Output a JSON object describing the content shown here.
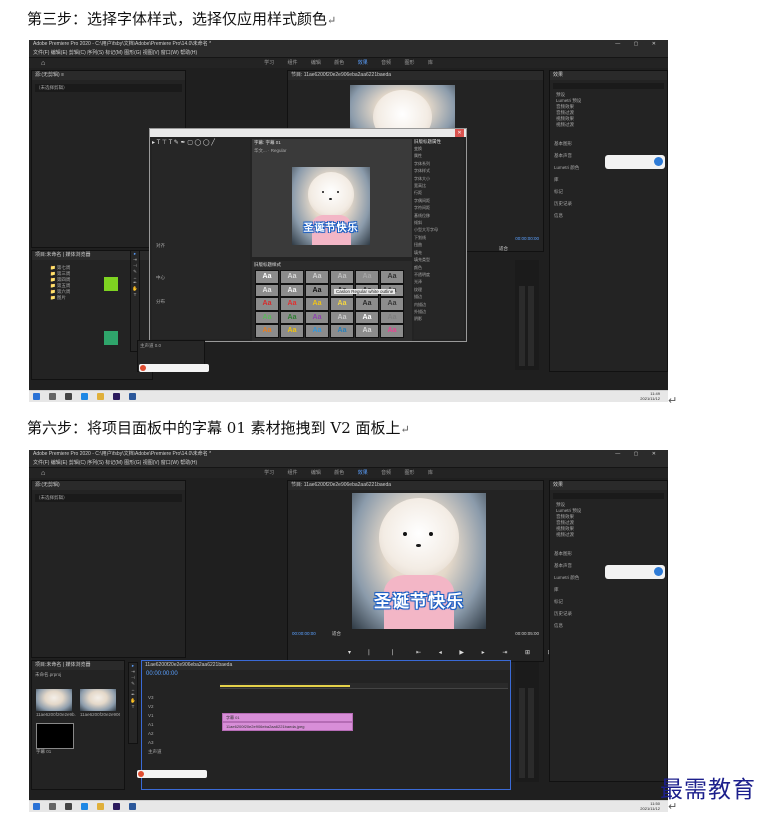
{
  "step3": {
    "heading": "第三步：选择字体样式，选择仅应用样式颜色",
    "app_title": "Adobe Premiere Pro 2020 - C:\\用户\\fsby\\文档\\Adobe\\Premiere Pro\\14.0\\未命名 *",
    "menu": "文件(F)  编辑(E)  剪辑(C)  序列(S)  标记(M)  图形(G)  视图(V)  窗口(W)  帮助(H)",
    "workspaces": [
      "学习",
      "组件",
      "编辑",
      "颜色",
      "效果",
      "音频",
      "图形",
      "库"
    ],
    "active_workspace": "效果",
    "project_tab": "项目:未命名",
    "media_tab": "媒体浏览器",
    "source_placeholder": "（未选择剪辑）",
    "program_tab": "节目: 11ae6200f20e2e906eba2aa6221baeda",
    "effects_tab": "效果",
    "effects_items": [
      "预设",
      "Lumetri 预设",
      "音频效果",
      "音频过渡",
      "视频效果",
      "视频过渡"
    ],
    "effects_side": [
      "基本图形",
      "基本声音",
      "Lumetri 颜色",
      "库",
      "标记",
      "历史记录",
      "信息"
    ],
    "titler_title": "字幕: 字幕 01",
    "titler_font": "华文...",
    "titler_weight": "Regular",
    "caption_text": "圣诞节快乐",
    "styles_header": "旧版标题样式",
    "properties_header": "旧版标题属性",
    "style_tooltip": "Caslon Regular white outline",
    "props": [
      "变换",
      "属性",
      "字体系列",
      "字体样式",
      "字体大小",
      "宽高比",
      "行距",
      "字偶间距",
      "字符间距",
      "基线位移",
      "倾斜",
      "小型大写字母",
      "下划线",
      "扭曲",
      "填充",
      "填充类型",
      "颜色",
      "不透明度",
      "光泽",
      "纹理",
      "描边",
      "内描边",
      "外描边",
      "阴影"
    ],
    "timecode": "00:00:00:00",
    "fit": "适合",
    "clock_time": "11:49",
    "clock_date": "2021/11/12"
  },
  "step6": {
    "heading": "第六步：将项目面板中的字幕 01 素材拖拽到 V2 面板上",
    "app_title": "Adobe Premiere Pro 2020 - C:\\用户\\fsby\\文档\\Adobe\\Premiere Pro\\14.0\\未命名 *",
    "menu": "文件(F)  编辑(E)  剪辑(C)  序列(S)  标记(M)  图形(G)  视图(V)  窗口(W)  帮助(H)",
    "workspaces": [
      "学习",
      "组件",
      "编辑",
      "颜色",
      "效果",
      "音频",
      "图形",
      "库"
    ],
    "active_workspace": "效果",
    "source_tab": "源:(无剪辑)",
    "source_placeholder": "（未选择剪辑）",
    "program_tab": "节目: 11ae6200f20e2e906eba2aa6221baeda",
    "caption_text": "圣诞节快乐",
    "timecode": "00:00:00:00",
    "duration": "00:00:05:00",
    "fit": "适合",
    "project_tab": "项目:未命名",
    "media_tab": "媒体浏览器",
    "project_file": "未命名.prproj",
    "thumb_labels": [
      "11ae6200f20e2e9b...",
      "11ae6200f20e2e906...",
      "字幕 01"
    ],
    "sequence_tab": "11ae6200f20e2e906eba2aa6221baeda",
    "seq_timecode": "00:00:00:00",
    "tracks": [
      "V3",
      "V2",
      "V1",
      "A1",
      "A2",
      "A3",
      "主声道"
    ],
    "clip_v2": "字幕 01",
    "clip_v1": "11ae6200f20e2e906eba2aa6221baeda.jpeg",
    "effects_items": [
      "预设",
      "Lumetri 预设",
      "音频效果",
      "音频过渡",
      "视频效果",
      "视频过渡"
    ],
    "effects_side": [
      "基本图形",
      "基本声音",
      "Lumetri 颜色",
      "库",
      "标记",
      "历史记录",
      "信息"
    ],
    "clock_time": "11:50",
    "clock_date": "2021/11/12"
  },
  "watermark": "最需教育",
  "colors": {
    "accent": "#1c1f8c",
    "premiere_bg": "#1f1f1f",
    "clip": "#d88ed8",
    "caption_outline": "#1b5fc4"
  },
  "style_swatches": [
    {
      "t": "Aa",
      "bg": "#8c8c8c",
      "fg": "#ffffff"
    },
    {
      "t": "Aa",
      "bg": "#8c8c8c",
      "fg": "#d9d9d9"
    },
    {
      "t": "Aa",
      "bg": "#8c8c8c",
      "fg": "#cfcfcf"
    },
    {
      "t": "Aa",
      "bg": "#8c8c8c",
      "fg": "#bfbfbf"
    },
    {
      "t": "Aa",
      "bg": "#8c8c8c",
      "fg": "#a6a6a6"
    },
    {
      "t": "Aa",
      "bg": "#8c8c8c",
      "fg": "#333333"
    },
    {
      "t": "Aa",
      "bg": "#8c8c8c",
      "fg": "#e6e6e6"
    },
    {
      "t": "Aa",
      "bg": "#8c8c8c",
      "fg": "#f2f2f2"
    },
    {
      "t": "Aa",
      "bg": "#8c8c8c",
      "fg": "#111111"
    },
    {
      "t": "Aa",
      "bg": "#8c8c8c",
      "fg": "#222222"
    },
    {
      "t": "Aa",
      "bg": "#8c8c8c",
      "fg": "#2a2a2a"
    },
    {
      "t": "Aa",
      "bg": "#8c8c8c",
      "fg": "#444444"
    },
    {
      "t": "Aa",
      "bg": "#8c8c8c",
      "fg": "#d62b2b"
    },
    {
      "t": "Aa",
      "bg": "#8c8c8c",
      "fg": "#e03030"
    },
    {
      "t": "Aa",
      "bg": "#8c8c8c",
      "fg": "#f0c419"
    },
    {
      "t": "Aa",
      "bg": "#8c8c8c",
      "fg": "#f5d742"
    },
    {
      "t": "Aa",
      "bg": "#8c8c8c",
      "fg": "#2a2a2a"
    },
    {
      "t": "Aa",
      "bg": "#8c8c8c",
      "fg": "#3a3a3a"
    },
    {
      "t": "Aa",
      "bg": "#8c8c8c",
      "fg": "#5cb85c"
    },
    {
      "t": "Aa",
      "bg": "#8c8c8c",
      "fg": "#2e7d32"
    },
    {
      "t": "Aa",
      "bg": "#8c8c8c",
      "fg": "#8e44ad"
    },
    {
      "t": "Aa",
      "bg": "#8c8c8c",
      "fg": "#c9c9c9"
    },
    {
      "t": "Aa",
      "bg": "#8c8c8c",
      "fg": "#ffffff"
    },
    {
      "t": "Aa",
      "bg": "#8c8c8c",
      "fg": "#7f7f7f"
    },
    {
      "t": "Aa",
      "bg": "#8c8c8c",
      "fg": "#e67e22"
    },
    {
      "t": "Aa",
      "bg": "#8c8c8c",
      "fg": "#f1c40f"
    },
    {
      "t": "Aa",
      "bg": "#8c8c8c",
      "fg": "#3498db"
    },
    {
      "t": "Aa",
      "bg": "#8c8c8c",
      "fg": "#2980b9"
    },
    {
      "t": "Aa",
      "bg": "#8c8c8c",
      "fg": "#d8d8d8"
    },
    {
      "t": "Aa",
      "bg": "#8c8c8c",
      "fg": "#e84393"
    }
  ]
}
